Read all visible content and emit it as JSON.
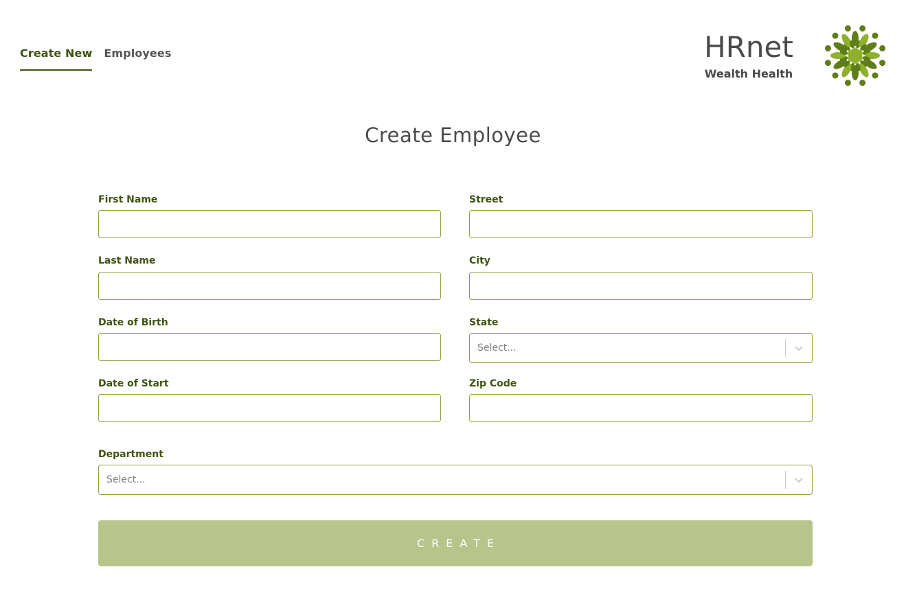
{
  "nav": {
    "items": [
      {
        "label": "Create New",
        "active": true
      },
      {
        "label": "Employees",
        "active": false
      }
    ]
  },
  "brand": {
    "title": "HRnet",
    "subtitle": "Wealth Health",
    "logo_icon": "green-mandala-logo",
    "accent_color": "#5f7d1a"
  },
  "page": {
    "title": "Create Employee"
  },
  "form": {
    "first_name": {
      "label": "First Name",
      "value": ""
    },
    "last_name": {
      "label": "Last Name",
      "value": ""
    },
    "date_of_birth": {
      "label": "Date of Birth",
      "value": ""
    },
    "date_of_start": {
      "label": "Date of Start",
      "value": ""
    },
    "street": {
      "label": "Street",
      "value": ""
    },
    "city": {
      "label": "City",
      "value": ""
    },
    "state": {
      "label": "State",
      "placeholder": "Select..."
    },
    "zip_code": {
      "label": "Zip Code",
      "value": ""
    },
    "department": {
      "label": "Department",
      "placeholder": "Select..."
    },
    "submit_label": "CREATE"
  },
  "colors": {
    "label_green": "#3e5311",
    "input_border": "#8aa33a",
    "button_bg": "#b8c58a"
  }
}
